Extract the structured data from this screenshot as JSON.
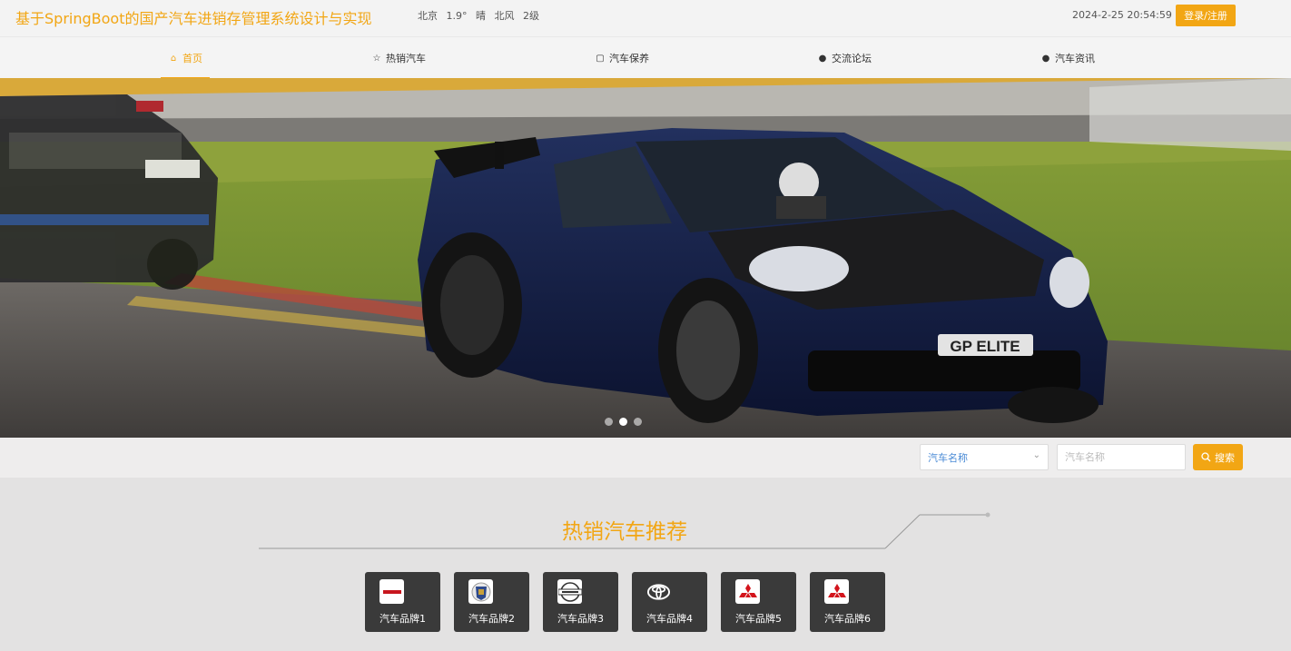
{
  "header": {
    "title": "基于SpringBoot的国产汽车进销存管理系统设计与实现",
    "weather": {
      "city": "北京",
      "temp": "1.9°",
      "condition": "晴",
      "wind": "北风",
      "level": "2级"
    },
    "datetime": "2024-2-25 20:54:59",
    "login_label": "登录/注册"
  },
  "nav": {
    "items": [
      {
        "label": "首页",
        "icon": "home-icon",
        "active": true
      },
      {
        "label": "热销汽车",
        "icon": "star-icon"
      },
      {
        "label": "汽车保养",
        "icon": "bag-icon"
      },
      {
        "label": "交流论坛",
        "icon": "info-icon"
      },
      {
        "label": "汽车资讯",
        "icon": "help-icon"
      }
    ]
  },
  "banner": {
    "plate": "GP ELITE",
    "slide_count": 3,
    "active_slide": 2
  },
  "search": {
    "select_value": "汽车名称",
    "input_placeholder": "汽车名称",
    "button_label": "搜索"
  },
  "hot": {
    "title": "热销汽车推荐",
    "brands": [
      {
        "label": "汽车品牌1",
        "logo": "honda-logo"
      },
      {
        "label": "汽车品牌2",
        "logo": "cadillac-logo"
      },
      {
        "label": "汽车品牌3",
        "logo": "nissan-logo"
      },
      {
        "label": "汽车品牌4",
        "logo": "toyota-logo"
      },
      {
        "label": "汽车品牌5",
        "logo": "mitsubishi-logo"
      },
      {
        "label": "汽车品牌6",
        "logo": "mitsubishi-logo"
      }
    ]
  },
  "colors": {
    "accent": "#f2a614",
    "card": "#3a3a3a"
  }
}
